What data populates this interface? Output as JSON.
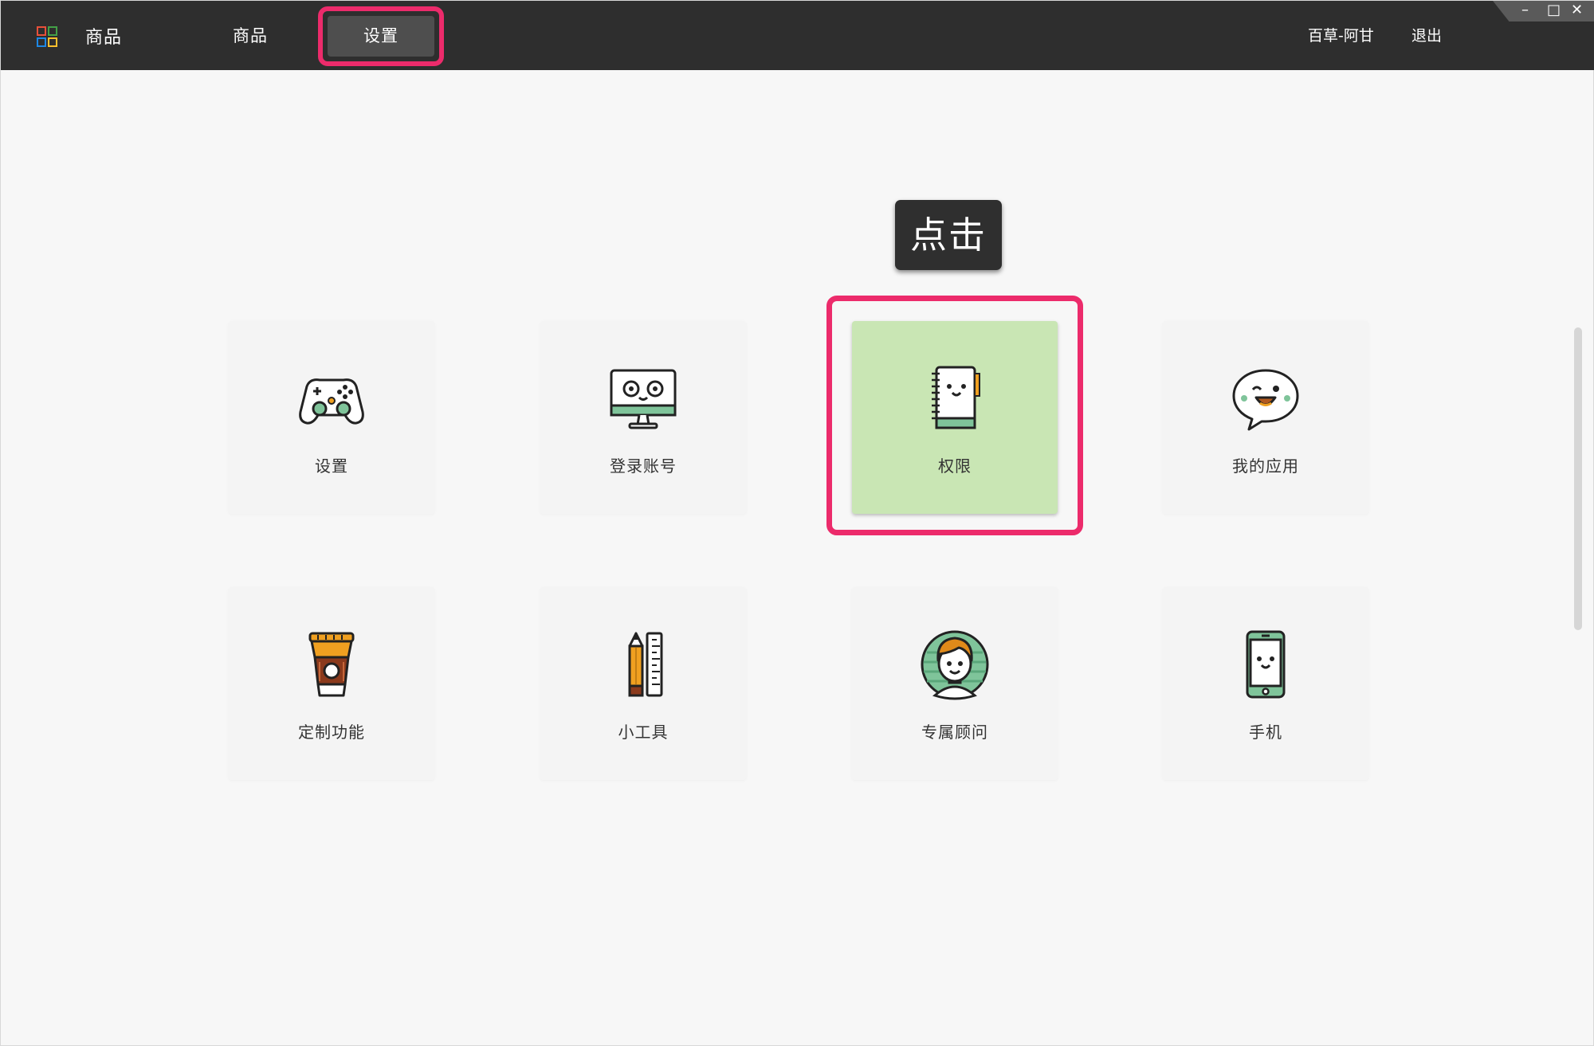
{
  "header": {
    "app_title": "商品",
    "nav": {
      "goods_label": "商品",
      "settings_label": "设置"
    },
    "user_name": "百草-阿甘",
    "logout_label": "退出",
    "window_controls": {
      "minimize": "–",
      "maximize": "□",
      "close": "✕"
    }
  },
  "tooltip": {
    "text": "点击"
  },
  "tiles": [
    {
      "label": "设置",
      "icon": "gamepad-icon",
      "active": false
    },
    {
      "label": "登录账号",
      "icon": "monitor-icon",
      "active": false
    },
    {
      "label": "权限",
      "icon": "notebook-icon",
      "active": true
    },
    {
      "label": "我的应用",
      "icon": "chat-bubble-icon",
      "active": false
    },
    {
      "label": "定制功能",
      "icon": "coffee-cup-icon",
      "active": false
    },
    {
      "label": "小工具",
      "icon": "pencil-ruler-icon",
      "active": false
    },
    {
      "label": "专属顾问",
      "icon": "advisor-avatar-icon",
      "active": false
    },
    {
      "label": "手机",
      "icon": "phone-icon",
      "active": false
    }
  ],
  "colors": {
    "topbar": "#2e2e2e",
    "highlight": "#ec2b6b",
    "active_tile": "#c9e6b4",
    "icon_green": "#7fc49a",
    "background": "#f7f7f7"
  }
}
